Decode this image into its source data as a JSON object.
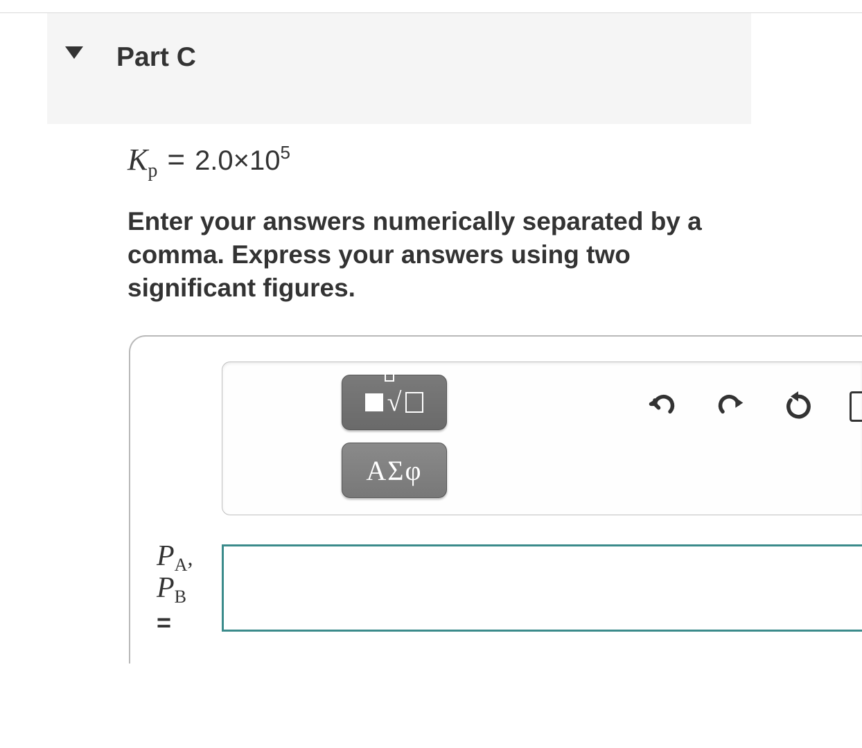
{
  "part": {
    "title": "Part C"
  },
  "equation": {
    "variable": "K",
    "subscript": "p",
    "equals": "=",
    "coefficient": "2.0×10",
    "exponent": "5"
  },
  "instructions": "Enter your answers numerically separated by a comma. Express your answers using two significant figures.",
  "palette": {
    "math_label": "math-templates",
    "greek_label": "ΑΣφ"
  },
  "toolbar": {
    "undo": "undo",
    "redo": "redo",
    "reset": "reset",
    "keyboard": "keyboard"
  },
  "answer": {
    "var1": "P",
    "sub1": "A",
    "comma": ",",
    "var2": "P",
    "sub2": "B",
    "equals": "=",
    "value": ""
  }
}
